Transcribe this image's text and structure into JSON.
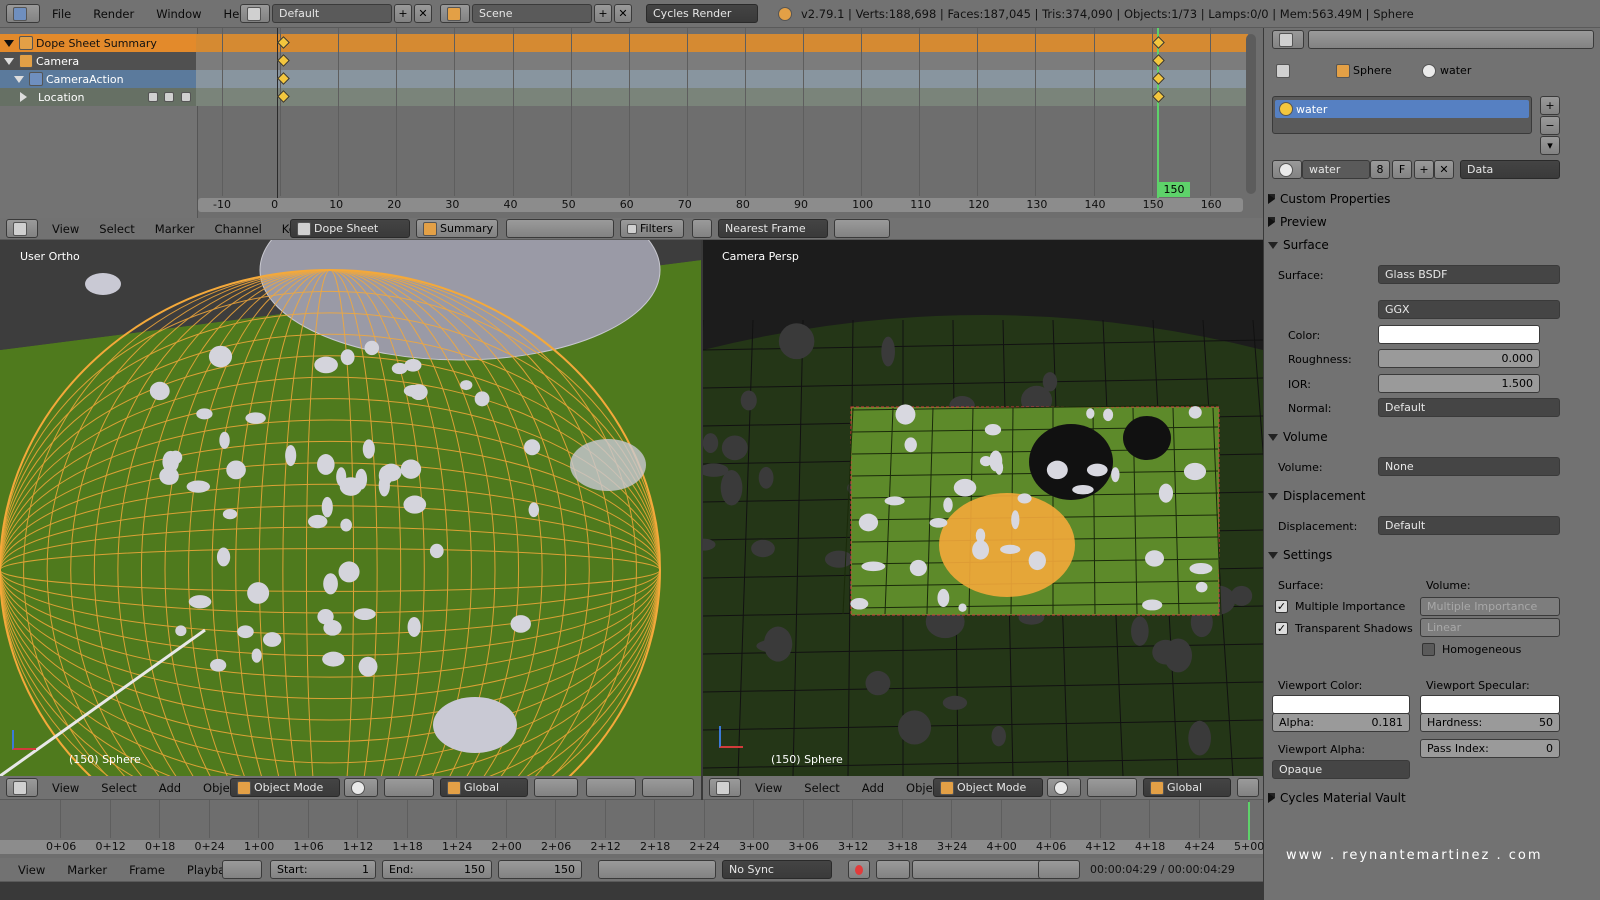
{
  "top_bar": {
    "menus": [
      "File",
      "Render",
      "Window",
      "Help"
    ],
    "layout": "Default",
    "scene": "Scene",
    "engine": "Cycles Render",
    "status": "v2.79.1 | Verts:188,698 | Faces:187,045 | Tris:374,090 | Objects:1/73 | Lamps:0/0 | Mem:563.49M | Sphere"
  },
  "dopesheet": {
    "channels": [
      "Dope Sheet Summary",
      "Camera",
      "CameraAction",
      "Location"
    ],
    "ticks": [
      "-10",
      "0",
      "10",
      "20",
      "30",
      "40",
      "50",
      "60",
      "70",
      "80",
      "90",
      "100",
      "110",
      "120",
      "130",
      "140",
      "150",
      "160"
    ],
    "current_frame": "150",
    "header": {
      "menus": [
        "View",
        "Select",
        "Marker",
        "Channel",
        "Key"
      ],
      "mode": "Dope Sheet",
      "summary": "Summary",
      "filters": "Filters",
      "snap": "Nearest Frame"
    }
  },
  "viewport_left": {
    "label": "User Ortho",
    "footer": "(150) Sphere",
    "header": {
      "menus": [
        "View",
        "Select",
        "Add",
        "Object"
      ],
      "mode": "Object Mode",
      "orientation": "Global"
    }
  },
  "viewport_right": {
    "label": "Camera Persp",
    "footer": "(150) Sphere",
    "header": {
      "menus": [
        "View",
        "Select",
        "Add",
        "Object"
      ],
      "mode": "Object Mode",
      "orientation": "Global"
    }
  },
  "timeline": {
    "ticks": [
      "0+06",
      "0+12",
      "0+18",
      "0+24",
      "1+00",
      "1+06",
      "1+12",
      "1+18",
      "1+24",
      "2+00",
      "2+06",
      "2+12",
      "2+18",
      "2+24",
      "3+00",
      "3+06",
      "3+12",
      "3+18",
      "3+24",
      "4+00",
      "4+06",
      "4+12",
      "4+18",
      "4+24",
      "5+00"
    ],
    "menus": [
      "View",
      "Marker",
      "Frame",
      "Playback"
    ],
    "start_label": "Start:",
    "start": "1",
    "end_label": "End:",
    "end": "150",
    "frame": "150",
    "sync": "No Sync",
    "time": "00:00:04:29 / 00:00:04:29"
  },
  "properties": {
    "breadcrumb": {
      "object": "Sphere",
      "material": "water"
    },
    "material_slot": "water",
    "material_name": "water",
    "users": "8",
    "fake": "F",
    "link": "Data",
    "sections": {
      "custom": "Custom Properties",
      "preview": "Preview",
      "surface": "Surface",
      "volume": "Volume",
      "displacement": "Displacement",
      "settings": "Settings",
      "vault": "Cycles Material Vault"
    },
    "surface": {
      "surface_label": "Surface:",
      "surface": "Glass BSDF",
      "distribution": "GGX",
      "color_label": "Color:",
      "roughness_label": "Roughness:",
      "roughness": "0.000",
      "ior_label": "IOR:",
      "ior": "1.500",
      "normal_label": "Normal:",
      "normal": "Default"
    },
    "volume": {
      "label": "Volume:",
      "value": "None"
    },
    "displacement": {
      "label": "Displacement:",
      "value": "Default"
    },
    "settings": {
      "surface_head": "Surface:",
      "volume_head": "Volume:",
      "multiple_importance": "Multiple Importance",
      "transparent_shadows": "Transparent Shadows",
      "vol_sampling": "Multiple Importance",
      "vol_interp": "Linear",
      "homogeneous": "Homogeneous",
      "viewport_color": "Viewport Color:",
      "viewport_specular": "Viewport Specular:",
      "alpha_label": "Alpha:",
      "alpha": "0.181",
      "hardness_label": "Hardness:",
      "hardness": "50",
      "viewport_alpha": "Viewport Alpha:",
      "opaque": "Opaque",
      "pass_label": "Pass Index:",
      "pass": "0"
    }
  },
  "watermark": "www . reynantemartinez . com",
  "colors": {
    "select": "#f08a2a",
    "wire": "#f4a93a",
    "floor": "#4f7a1d",
    "active_blue": "#5680c2"
  }
}
